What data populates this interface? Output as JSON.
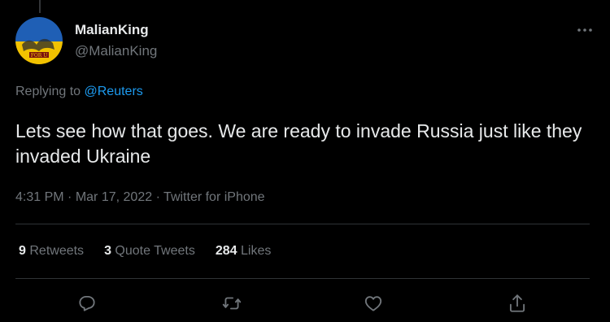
{
  "tweet": {
    "author": {
      "display_name": "MalianKing",
      "handle": "@MalianKing",
      "avatar_label": "FOR U"
    },
    "reply_to": {
      "prefix": "Replying to",
      "mention": "@Reuters"
    },
    "text": "Lets see how that goes. We are ready to invade Russia just like they invaded Ukraine",
    "time": "4:31 PM",
    "separator": "·",
    "date": "Mar 17, 2022",
    "source": "Twitter for iPhone",
    "stats": {
      "retweets_count": "9",
      "retweets_label": "Retweets",
      "quotes_count": "3",
      "quotes_label": "Quote Tweets",
      "likes_count": "284",
      "likes_label": "Likes"
    },
    "actions": {
      "reply_icon": "reply-icon",
      "retweet_icon": "retweet-icon",
      "like_icon": "heart-icon",
      "share_icon": "share-icon"
    }
  },
  "colors": {
    "background": "#000000",
    "text": "#e7e9ea",
    "muted": "#71767b",
    "accent": "#1d9bf0",
    "divider": "#2f3336",
    "flag_blue": "#1f5fb5",
    "flag_yellow": "#f2c200"
  }
}
